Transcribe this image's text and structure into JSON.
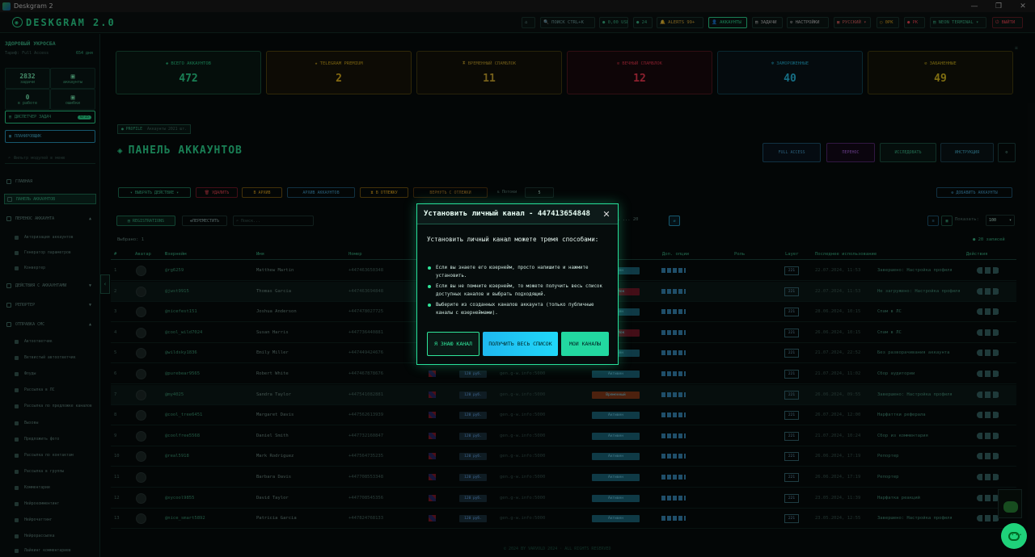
{
  "window": {
    "title": "Deskgram 2",
    "min": "—",
    "max": "❐",
    "close": "✕"
  },
  "topbar": {
    "logo": "DESKGRAM 2.0",
    "items": [
      {
        "label": "⌂",
        "icon": "home-icon"
      },
      {
        "label": "🔍 ПОИСК  CTRL+K",
        "icon": "search-icon"
      },
      {
        "label": "● 0,00 USD",
        "icon": "balance-icon"
      },
      {
        "label": "● 24",
        "icon": "counter-icon"
      },
      {
        "label": "🔔 ALERTS 99+",
        "icon": "bell-icon"
      },
      {
        "label": "👤 АККАУНТЫ",
        "icon": "accounts-icon"
      },
      {
        "label": "▤ ЗАДАЧИ",
        "icon": "tasks-icon"
      },
      {
        "label": "⚙ НАСТРОЙКИ",
        "icon": "gear-icon"
      },
      {
        "label": "▣ РУССКИЙ ▾",
        "icon": "language-icon"
      },
      {
        "label": "◯ 0РК",
        "icon": "cpu-icon"
      },
      {
        "label": "● РК",
        "icon": "status-icon"
      },
      {
        "label": "▤ NEON TERMINAL ▾",
        "icon": "theme-icon"
      },
      {
        "label": "⏻ ВЫЙТИ",
        "icon": "logout-icon"
      }
    ]
  },
  "sidebar": {
    "user": "ЗДОРОВЫЙ УКРОСБА",
    "plan": "Тариф: Full Access",
    "days": "654 дня",
    "mini_stats": [
      {
        "value": "2832",
        "label": "задачи"
      },
      {
        "value": "",
        "label": "аккаунты"
      },
      {
        "value": "0",
        "label": "в работе"
      },
      {
        "value": "",
        "label": "ошибки"
      }
    ],
    "dispatcher": "ДИСПЕТЧЕР ЗАДАЧ",
    "dispatcher_badge": "0/15",
    "planning": "ПЛАНИРОВЩИК",
    "search_placeholder": "Фильтр модулей в меню",
    "nav": [
      {
        "label": "ГЛАВНАЯ"
      },
      {
        "label": "ПАНЕЛЬ АККАУНТОВ"
      },
      {
        "label": "ПЕРЕНОС АККАУНТА"
      }
    ],
    "sub1": [
      "Авторизация аккаунтов",
      "Генератор параметров",
      "Конвертер"
    ],
    "nav2": [
      {
        "label": "ДЕЙСТВИЯ С АККАУНТАМИ"
      },
      {
        "label": "РЕПОРТЕР"
      },
      {
        "label": "ОТПРАВКА СМС"
      }
    ],
    "sub2": [
      "Автоответчик",
      "Ветвистый автоответчик",
      "Флуды",
      "Рассылка в ЛС",
      "Рассылка по предложке каналов",
      "Вызовы",
      "Предложить фото",
      "Рассылка по контактам",
      "Рассылка в группы",
      "Комментарии",
      "Нейрокомментинг",
      "Нейрочаттинг",
      "Нейрорассылка",
      "Лайкинг комментариев"
    ]
  },
  "cards": [
    {
      "label": "ВСЕГО АККАУНТОВ",
      "value": "472",
      "color": "#2fe69a"
    },
    {
      "label": "TELEGRAM PREMIUM",
      "value": "2",
      "color": "#f0c020"
    },
    {
      "label": "ВРЕМЕННЫЙ СПАМБЛОК",
      "value": "11",
      "color": "#d8b030"
    },
    {
      "label": "ВЕЧНЫЙ СПАМБЛОК",
      "value": "12",
      "color": "#ff3b55"
    },
    {
      "label": "ЗАМОРОЖЕННЫЕ",
      "value": "40",
      "color": "#29c8f0"
    },
    {
      "label": "ЗАБАНЕННЫЕ",
      "value": "49",
      "color": "#e8c820"
    }
  ],
  "panel": {
    "profile_tag": "● PROFILE",
    "profile_sub": "Аккаунты 2021 шт.",
    "title": "ПАНЕЛЬ АККАУНТОВ",
    "head_buttons": [
      "FULL ACCESS",
      "ПЕРЕНОС",
      "ИССЛЕДОВАТЬ",
      "ИНСТРУКЦИЯ",
      "⚙"
    ],
    "action_buttons": [
      "▾ ВЫБРАТЬ ДЕЙСТВИЕ ▾",
      "🗑 УДАЛИТЬ",
      "В АРХИВ",
      "АРХИВ АККАУНТОВ",
      "⧗ В ОТЛЕЖКУ",
      "ВЕРНУТЬ С ОТЛЕЖКИ"
    ],
    "threads_label": "Потоки",
    "threads_value": "5",
    "add_button": "⊕ ДОБАВИТЬ АККАУНТЫ",
    "reg_button": "REGISTRATIONS",
    "move_button": "ПЕРЕМЕСТИТЬ",
    "search_placeholder": "Поиск...",
    "selected": "Выбрано: 1",
    "pagination": "1 ... 20",
    "show_label": "Показать:",
    "show_value": "100",
    "records": "● 20 записей"
  },
  "table": {
    "columns": [
      "#",
      "Аватар",
      "Юзернейм",
      "Имя",
      "Номер",
      "",
      "",
      "",
      "Доп. опции",
      "Роль",
      "Layer",
      "Последнее использование",
      "Действия"
    ],
    "rows": [
      {
        "n": "1",
        "user": "@rg6259",
        "name": "Matthew Martin",
        "phone": "+447463650348",
        "status": "Активен",
        "date": "22.07.2024, 11:53",
        "note": "Завершено: Настройка профиля",
        "status_color": "#1d6b80"
      },
      {
        "n": "2",
        "user": "@jwst9915",
        "name": "Thomas Garcia",
        "phone": "+447463694848",
        "status": "Спамблок",
        "date": "22.07.2024, 11:53",
        "note": "Не загружено: Настройка профиля",
        "status_color": "#7a1a2a"
      },
      {
        "n": "3",
        "user": "@nicefest151",
        "name": "Joshua Anderson",
        "phone": "+447478027725",
        "status": "Активен",
        "date": "28.06.2024, 10:15",
        "note": "Спам в ЛС",
        "status_color": "#1d6b80"
      },
      {
        "n": "4",
        "user": "@cool_wild7024",
        "name": "Susan Harris",
        "phone": "+447736440881",
        "status": "Спамблок",
        "date": "26.06.2024, 10:15",
        "note": "Спам в ЛС",
        "status_color": "#7a1a2a"
      },
      {
        "n": "5",
        "user": "@wildsky1836",
        "name": "Emily Miller",
        "phone": "+447449424676",
        "status": "Активен",
        "date": "21.07.2024, 22:52",
        "note": "Без разворачивания аккаунта",
        "status_color": "#1d6b80"
      },
      {
        "n": "6",
        "user": "@purebear9565",
        "name": "Robert White",
        "phone": "+447467878676",
        "status": "Активен",
        "date": "21.07.2024, 11:02",
        "note": "Сбор аудитории",
        "status_color": "#1d6b80"
      },
      {
        "n": "7",
        "user": "@my4025",
        "name": "Sandra Taylor",
        "phone": "+447541082881",
        "status": "Временный",
        "date": "26.06.2024, 09:55",
        "note": "Завершено: Настройка профиля",
        "status_color": "#8a3c1a"
      },
      {
        "n": "8",
        "user": "@cool_tree6451",
        "name": "Margaret Davis",
        "phone": "+447562613939",
        "status": "Активен",
        "date": "26.07.2024, 12:00",
        "note": "Нарфаттки реферала",
        "status_color": "#1d6b80"
      },
      {
        "n": "9",
        "user": "@coolfree5568",
        "name": "Daniel Smith",
        "phone": "+447732160847",
        "status": "Активен",
        "date": "21.07.2024, 10:24",
        "note": "Сбор из комментария",
        "status_color": "#1d6b80"
      },
      {
        "n": "10",
        "user": "@real5918",
        "name": "Mark Rodriguez",
        "phone": "+447564735235",
        "status": "Активен",
        "date": "26.06.2024, 17:19",
        "note": "Репортер",
        "status_color": "#1d6b80"
      },
      {
        "n": "11",
        "user": "",
        "name": "Barbara Davis",
        "phone": "+447708553348",
        "status": "Активен",
        "date": "26.06.2024, 17:19",
        "note": "Репортер",
        "status_color": "#1d6b80"
      },
      {
        "n": "12",
        "user": "@xycool9855",
        "name": "David Taylor",
        "phone": "+447708545356",
        "status": "Активен",
        "date": "23.05.2024, 11:39",
        "note": "Нарфатка реакций",
        "status_color": "#1d6b80"
      },
      {
        "n": "13",
        "user": "@nice_smart5892",
        "name": "Patricia Garcia",
        "phone": "+447824768133",
        "status": "Активен",
        "date": "23.05.2024, 12:55",
        "note": "Завершено: Настройка профиля",
        "status_color": "#1d6b80"
      }
    ],
    "balance": "120 руб.",
    "proxy": "gen.g-w.info:5000",
    "layer": "221"
  },
  "footer": "© 2024 BY VARVOLD 2024 · ALL RIGHTS RESERVED",
  "modal": {
    "title": "Установить личный канал - 447413654848",
    "close": "✕",
    "intro": "Установить личный канал можете тремя способами:",
    "items": [
      "Если вы знаете его юзернейм, просто напишите и нажмите установить.",
      "Если вы не помните юзернейм, то можете получить весь список доступных каналов и выбрать подходящий.",
      "Выберите из созданных каналов аккаунта (только публичные каналы с юзернеймами)."
    ],
    "buttons": [
      "Я ЗНАЮ КАНАЛ",
      "ПОЛУЧИТЬ ВЕСЬ СПИСОК",
      "МОИ КАНАЛЫ"
    ]
  },
  "chat_icon": "chat-bubble-icon"
}
